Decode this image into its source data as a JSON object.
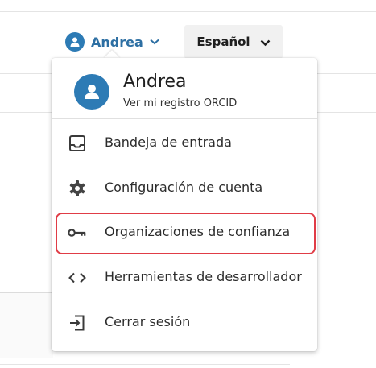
{
  "topbar": {
    "user_name": "Andrea",
    "language_label": "Español"
  },
  "menu": {
    "header_name": "Andrea",
    "header_link": "Ver mi registro ORCID",
    "items": [
      {
        "label": "Bandeja de entrada",
        "icon": "inbox-icon"
      },
      {
        "label": "Configuración de cuenta",
        "icon": "gear-icon"
      },
      {
        "label": "Organizaciones de confianza",
        "icon": "key-icon",
        "highlighted": true
      },
      {
        "label": "Herramientas de desarrollador",
        "icon": "code-icon"
      },
      {
        "label": "Cerrar sesión",
        "icon": "logout-icon"
      }
    ]
  },
  "colors": {
    "accent": "#2d7bb5",
    "user_name": "#2d6fa3",
    "highlight_border": "#e03c46"
  }
}
